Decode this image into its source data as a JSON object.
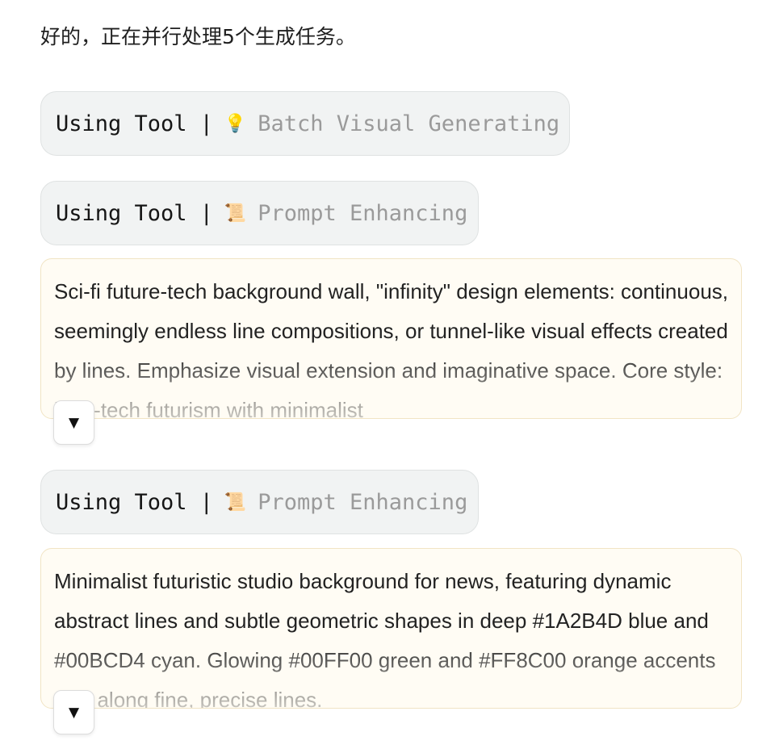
{
  "intro_text": "好的，正在并行处理5个生成任务。",
  "tool_calls": [
    {
      "prefix": "Using Tool",
      "separator": "|",
      "icon": "💡",
      "icon_name": "lightbulb-icon",
      "name": "Batch Visual Generating"
    },
    {
      "prefix": "Using Tool",
      "separator": "|",
      "icon": "📜",
      "icon_name": "scroll-icon",
      "name": "Prompt Enhancing"
    },
    {
      "prefix": "Using Tool",
      "separator": "|",
      "icon": "📜",
      "icon_name": "scroll-icon",
      "name": "Prompt Enhancing"
    }
  ],
  "prompts": [
    {
      "text": "Sci-fi future-tech background wall, \"infinity\" design elements: continuous, seemingly endless line compositions, or tunnel-like visual effects created by lines. Emphasize visual extension and imaginative space. Core style: high-tech futurism with minimalist"
    },
    {
      "text": "Minimalist futuristic studio background for news, featuring dynamic abstract lines and subtle geometric shapes in deep #1A2B4D blue and #00BCD4 cyan. Glowing #00FF00 green and #FF8C00 orange accents flow along fine, precise lines."
    }
  ],
  "expand_icon": "▼",
  "colors": {
    "pill_bg": "#f1f3f3",
    "pill_border": "#dfe2e2",
    "tool_name": "#9a9a9a",
    "prompt_bg": "#fffcf4",
    "prompt_border": "#f1e4c4"
  }
}
